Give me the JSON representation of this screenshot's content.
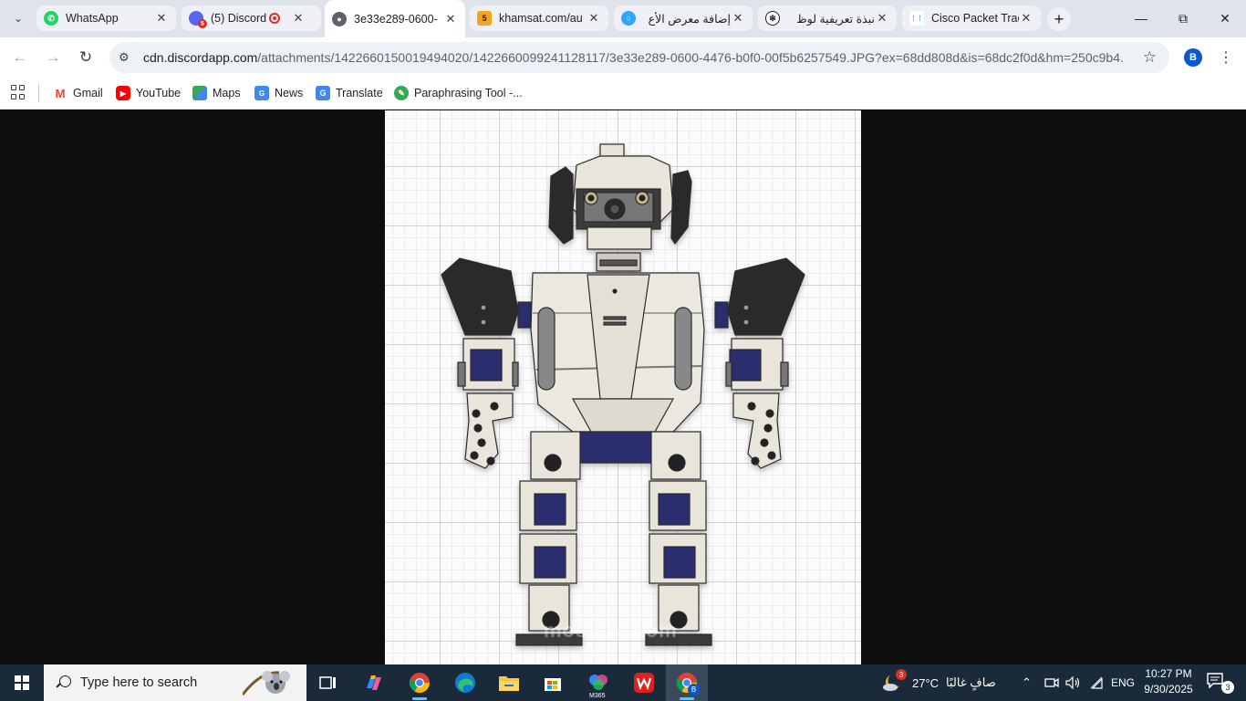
{
  "browser": {
    "tabs": [
      {
        "title": "WhatsApp",
        "favicon": "whatsapp-icon",
        "color": "#25d366"
      },
      {
        "title": "(5) Discord |",
        "favicon": "discord-icon",
        "color": "#5865f2",
        "badge": "5"
      },
      {
        "title": "3e33e289-0600-",
        "favicon": "globe-icon",
        "color": "#5f6368",
        "active": true
      },
      {
        "title": "khamsat.com/au",
        "favicon": "khamsat-icon",
        "color": "#f2a51a",
        "badge_text": "5"
      },
      {
        "title": "إضافة معرض الأع",
        "favicon": "mostaql-icon",
        "color": "#2ea6ff"
      },
      {
        "title": "نبذة تعريفية لوظ",
        "favicon": "chatgpt-icon",
        "color": "#1f1f1f"
      },
      {
        "title": "Cisco Packet Trac",
        "favicon": "cisco-icon",
        "color": "#049fd9"
      }
    ],
    "url_host": "cdn.discordapp.com",
    "url_path": "/attachments/1422660150019494020/1422660099241128117/3e33e289-0600-4476-b0f0-00f5b6257549.JPG?ex=68dd808d&is=68dc2f0d&hm=250c9b4...",
    "profile_initial": "B",
    "bookmarks": [
      {
        "label": "Gmail",
        "icon": "gmail-icon"
      },
      {
        "label": "YouTube",
        "icon": "youtube-icon"
      },
      {
        "label": "Maps",
        "icon": "maps-icon"
      },
      {
        "label": "News",
        "icon": "news-icon"
      },
      {
        "label": "Translate",
        "icon": "translate-icon"
      },
      {
        "label": "Paraphrasing Tool -...",
        "icon": "paraphrase-icon"
      }
    ]
  },
  "image": {
    "subject": "humanoid robot CAD render on grid",
    "watermark": "mostaql.com"
  },
  "taskbar": {
    "search_placeholder": "Type here to search",
    "weather_temp": "27°C",
    "weather_text": "صافٍ غالبًا",
    "weather_badge": "3",
    "language": "ENG",
    "time": "10:27 PM",
    "date": "9/30/2025",
    "notification_count": "3",
    "m365_label": "M365",
    "chrome_profile_badge": "B"
  },
  "colors": {
    "accent": "#0b57d0",
    "taskbar": "#1b2a3a",
    "robot_body": "#e9e5da",
    "robot_dark": "#222222",
    "servo": "#2a2d6e"
  }
}
